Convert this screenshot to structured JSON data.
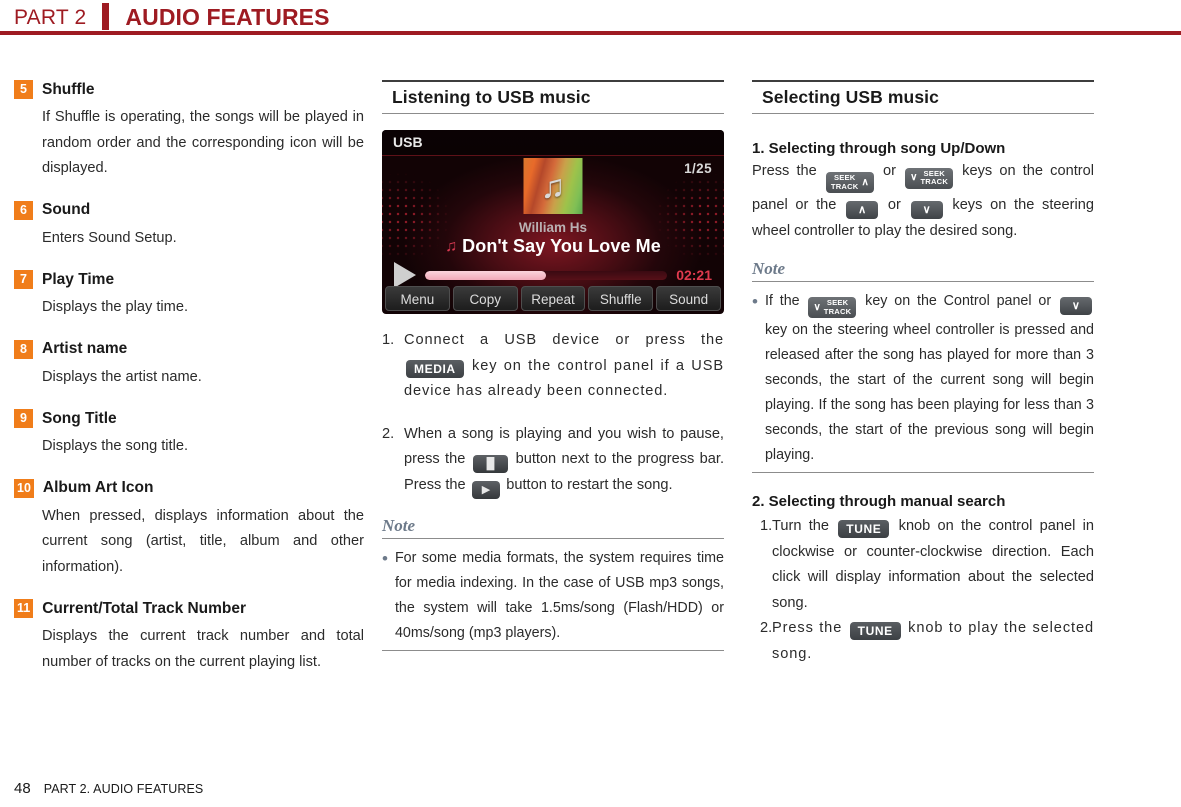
{
  "header": {
    "part_label": "PART 2",
    "title": "AUDIO FEATURES",
    "accent_color": "#9e1b22"
  },
  "badge_color": "#f07d1a",
  "left_column": {
    "items": [
      {
        "number": "5",
        "title": "Shuffle",
        "description": "If Shuffle is operating, the songs will be played in random order and the corresponding icon will be displayed."
      },
      {
        "number": "6",
        "title": "Sound",
        "description": "Enters Sound Setup."
      },
      {
        "number": "7",
        "title": "Play Time",
        "description": "Displays the play time."
      },
      {
        "number": "8",
        "title": "Artist name",
        "description": "Displays the artist name."
      },
      {
        "number": "9",
        "title": "Song Title",
        "description": "Displays the song title."
      },
      {
        "number": "10",
        "title": "Album Art Icon",
        "description": "When pressed, displays information about the current song (artist, title, album and other information)."
      },
      {
        "number": "11",
        "title": "Current/Total Track Number",
        "description": "Displays the current track number and total number of tracks on the current playing list."
      }
    ]
  },
  "middle_column": {
    "section_heading": "Listening to USB music",
    "device_screen": {
      "source_label": "USB",
      "track_counter": "1/25",
      "album_art_icon": "music-note-icon",
      "artist": "William Hs",
      "song_title": "Don't Say You Love Me",
      "song_note_icon": "music-note-icon",
      "play_icon": "play-icon",
      "elapsed_time": "02:21",
      "progress_percent": 50,
      "buttons": [
        "Menu",
        "Copy",
        "Repeat",
        "Shuffle",
        "Sound"
      ]
    },
    "steps": [
      {
        "number": "1.",
        "text_before": "Connect a USB device or press the",
        "key": "MEDIA",
        "text_after": "key on the control panel if a USB device has already been connected."
      },
      {
        "number": "2.",
        "text_before": "When a song is playing and you wish to pause, press the",
        "key_pause": "pause-icon",
        "text_middle": "button next to the progress bar. Press the",
        "key_play": "play-icon",
        "text_after": "button to restart the song."
      }
    ],
    "note": {
      "title": "Note",
      "bullet": "For some media formats, the system requires time for media indexing. In the case of USB mp3 songs, the system will take 1.5ms/song (Flash/HDD) or 40ms/song (mp3 players)."
    }
  },
  "right_column": {
    "section_heading": "Selecting USB music",
    "section1": {
      "heading": "1. Selecting through song Up/Down",
      "text_1": "Press the",
      "key_seek_up": {
        "line1": "SEEK",
        "line2": "TRACK",
        "chevron": "∧",
        "chevron_position": "right"
      },
      "text_2": "or",
      "key_seek_down": {
        "line1": "SEEK",
        "line2": "TRACK",
        "chevron": "∨",
        "chevron_position": "left"
      },
      "text_3": "keys  on the control panel or the",
      "key_up": "∧",
      "text_4": "or",
      "key_down": "∨",
      "text_5": "keys on the steering wheel controller to play the desired song."
    },
    "note": {
      "title": "Note",
      "text_1": "If the",
      "key_seek_down": {
        "line1": "SEEK",
        "line2": "TRACK",
        "chevron": "∨"
      },
      "text_2": "key on the Control panel or",
      "key_down": "∨",
      "text_3": "key on the steering wheel controller is pressed and released after the song has played for more than 3 seconds, the start of the current song will begin playing. If the song has been playing for less than 3 seconds, the start of the previous song will begin playing."
    },
    "section2": {
      "heading": "2. Selecting through manual search",
      "steps": [
        {
          "number": "1.",
          "text_before": "Turn the",
          "key": "TUNE",
          "text_after": "knob on the control panel in clockwise or counter-clockwise direction. Each click will display information about the selected song."
        },
        {
          "number": "2.",
          "text_before": "Press the",
          "key": "TUNE",
          "text_after": "knob to play the selected song."
        }
      ]
    }
  },
  "footer": {
    "page_number": "48",
    "text": "PART 2. AUDIO FEATURES"
  }
}
